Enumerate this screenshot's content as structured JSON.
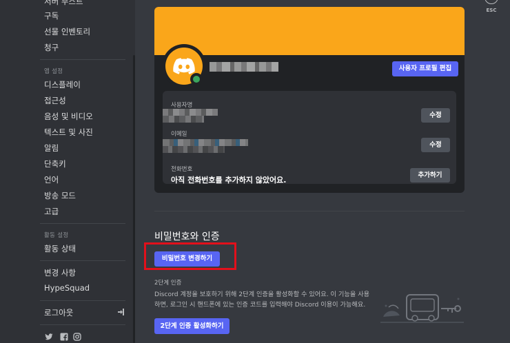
{
  "sidebar": {
    "top_items": [
      {
        "label": "서버 부스트"
      },
      {
        "label": "구독"
      },
      {
        "label": "선물 인벤토리"
      },
      {
        "label": "청구"
      }
    ],
    "app_settings_header": "앱 설정",
    "app_items": [
      {
        "label": "디스플레이"
      },
      {
        "label": "접근성"
      },
      {
        "label": "음성 및 비디오"
      },
      {
        "label": "텍스트 및 사진"
      },
      {
        "label": "알림"
      },
      {
        "label": "단축키"
      },
      {
        "label": "언어"
      },
      {
        "label": "방송 모드"
      },
      {
        "label": "고급"
      }
    ],
    "activity_header": "활동 설정",
    "activity_items": [
      {
        "label": "활동 상태"
      }
    ],
    "misc_items": [
      {
        "label": "변경 사항"
      },
      {
        "label": "HypeSquad"
      }
    ],
    "logout_label": "로그아웃",
    "social_icons": [
      "twitter-icon",
      "facebook-icon",
      "instagram-icon"
    ]
  },
  "close": {
    "label": "ESC"
  },
  "account_card": {
    "banner_color": "#faa61a",
    "edit_profile_label": "사용자 프로필 편집",
    "status_color": "#3ba55d",
    "username_label": "사용자명",
    "username_edit_label": "수정",
    "email_label": "이메일",
    "email_edit_label": "수정",
    "phone_label": "전화번호",
    "phone_value": "아직 전화번호를 추가하지 않았어요.",
    "phone_add_label": "추가하기"
  },
  "password_section": {
    "title": "비밀번호와 인증",
    "change_password_label": "비밀번호 변경하기",
    "tfa_header": "2단계 인증",
    "tfa_description": "Discord 계정을 보호하기 위해 2단계 인증을 활성화할 수 있어요. 이 기능을 사용하면, 로그인 시 핸드폰에 있는 인증 코드를 입력해야 Discord 이용이 가능해요.",
    "tfa_enable_label": "2단계 인증 활성화하기"
  },
  "colors": {
    "accent": "#5865f2",
    "highlight_box": "#e3101b"
  }
}
